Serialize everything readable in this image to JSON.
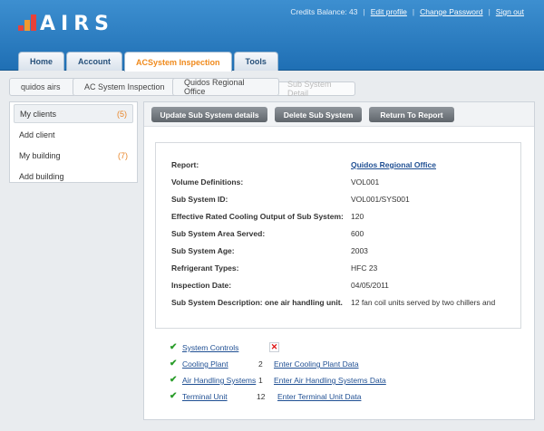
{
  "app": {
    "logo_text": "AIRS",
    "credits_label": "Credits Balance: 43",
    "links": [
      "Edit profile",
      "Change Password",
      "Sign out"
    ],
    "separator": "|"
  },
  "nav": {
    "tabs": [
      "Home",
      "Account",
      "ACSystem Inspection",
      "Tools"
    ],
    "active_tab": "ACSystem Inspection"
  },
  "breadcrumb": [
    "quidos airs",
    "AC System Inspection",
    "Quidos Regional Office",
    "Sub System Detail"
  ],
  "sidebar": {
    "items": [
      {
        "label": "My clients",
        "count": "(5)"
      },
      {
        "label": "Add client",
        "count": ""
      },
      {
        "label": "My building",
        "count": "(7)"
      },
      {
        "label": "Add building",
        "count": ""
      }
    ]
  },
  "toolbar": {
    "buttons": [
      "Update Sub System details",
      "Delete Sub System",
      "Return To Report"
    ]
  },
  "details": {
    "rows": [
      {
        "label": "Report:",
        "value": "Quidos Regional Office"
      },
      {
        "label": "Volume Definitions:",
        "value": "VOL001"
      },
      {
        "label": "Sub System ID:",
        "value": "VOL001/SYS001"
      },
      {
        "label": "Effective Rated Cooling Output of Sub System:",
        "value": "120"
      },
      {
        "label": "Sub System Area Served:",
        "value": "600"
      },
      {
        "label": "Sub System Age:",
        "value": "2003"
      },
      {
        "label": "Refrigerant Types:",
        "value": "HFC 23"
      },
      {
        "label": "Inspection Date:",
        "value": "04/05/2011"
      },
      {
        "label": "Sub System Description: one air handling unit.",
        "value": "12 fan coil units served by two chillers and"
      }
    ]
  },
  "checklist": [
    {
      "label": "System Controls",
      "count": "",
      "action": ""
    },
    {
      "label": "Cooling Plant",
      "count": "2",
      "action": "Enter Cooling Plant Data"
    },
    {
      "label": "Air Handling Systems",
      "count": "1",
      "action": "Enter Air Handling Systems Data"
    },
    {
      "label": "Terminal Unit",
      "count": "12",
      "action": "Enter Terminal Unit Data"
    }
  ],
  "icons": {
    "check": "check-icon",
    "remove": "close-icon"
  },
  "colors": {
    "header_blue": "#1f6fb4",
    "accent_orange": "#f08a1c",
    "link_blue": "#1f4f93",
    "check_green": "#2a9d2a",
    "remove_red": "#dd1111"
  }
}
